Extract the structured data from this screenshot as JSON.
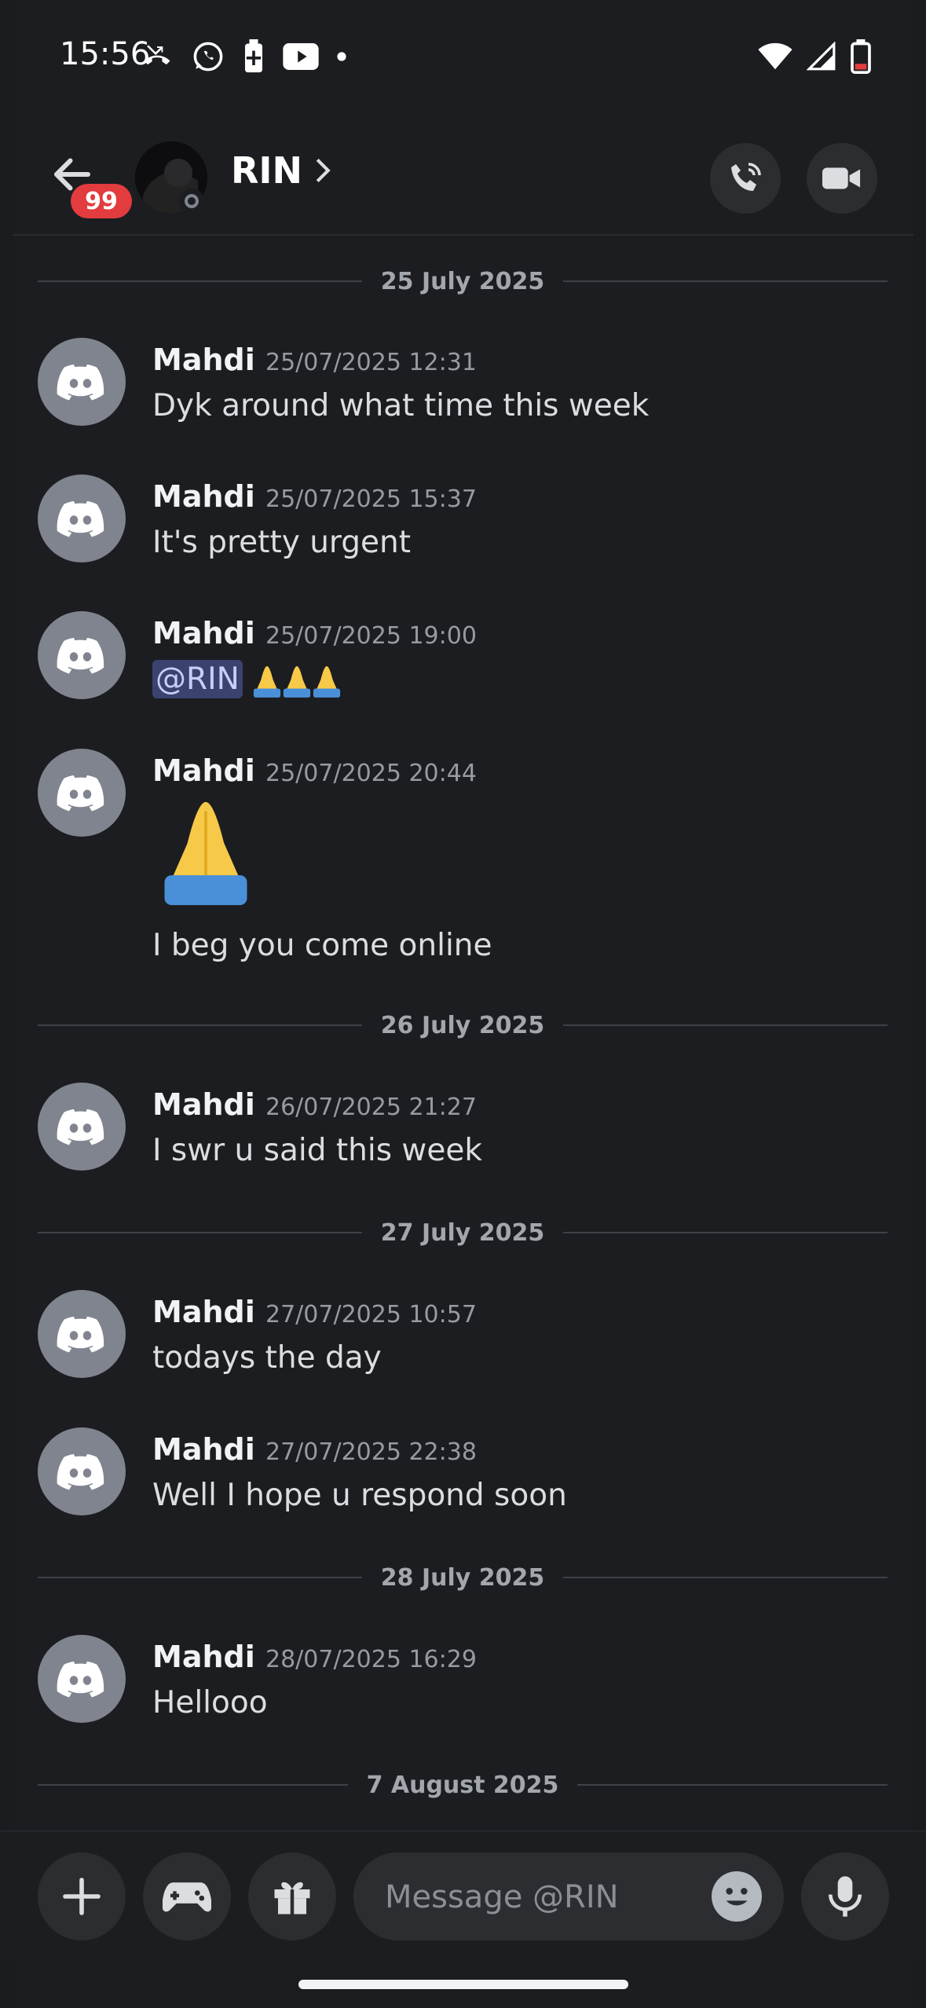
{
  "status_bar": {
    "time": "15:56"
  },
  "header": {
    "unread_count": "99",
    "title": "RIN"
  },
  "messages_area": {
    "items": [
      {
        "type": "date",
        "label": "25 July 2025"
      },
      {
        "type": "msg",
        "author": "Mahdi",
        "time": "25/07/2025 12:31",
        "text": "Dyk around what time this week"
      },
      {
        "type": "msg",
        "author": "Mahdi",
        "time": "25/07/2025 15:37",
        "text": "It's pretty urgent"
      },
      {
        "type": "msg",
        "author": "Mahdi",
        "time": "25/07/2025 19:00",
        "mention": "@RIN"
      },
      {
        "type": "msg",
        "author": "Mahdi",
        "time": "25/07/2025 20:44",
        "text": "I beg you come online"
      },
      {
        "type": "date",
        "label": "26 July 2025"
      },
      {
        "type": "msg",
        "author": "Mahdi",
        "time": "26/07/2025 21:27",
        "text": "I swr u said this week"
      },
      {
        "type": "date",
        "label": "27 July 2025"
      },
      {
        "type": "msg",
        "author": "Mahdi",
        "time": "27/07/2025 10:57",
        "text": "todays the day"
      },
      {
        "type": "msg",
        "author": "Mahdi",
        "time": "27/07/2025 22:38",
        "text": "Well I hope u respond soon"
      },
      {
        "type": "date",
        "label": "28 July 2025"
      },
      {
        "type": "msg",
        "author": "Mahdi",
        "time": "28/07/2025 16:29",
        "text": "Hellooo"
      },
      {
        "type": "date",
        "label": "7 August 2025"
      }
    ]
  },
  "composer": {
    "placeholder": "Message @RIN"
  },
  "colors": {
    "background": "#1c1d21",
    "accent_red": "#e23c3f",
    "avatar_grey": "#80848e",
    "mention_bg": "#3c4270"
  }
}
